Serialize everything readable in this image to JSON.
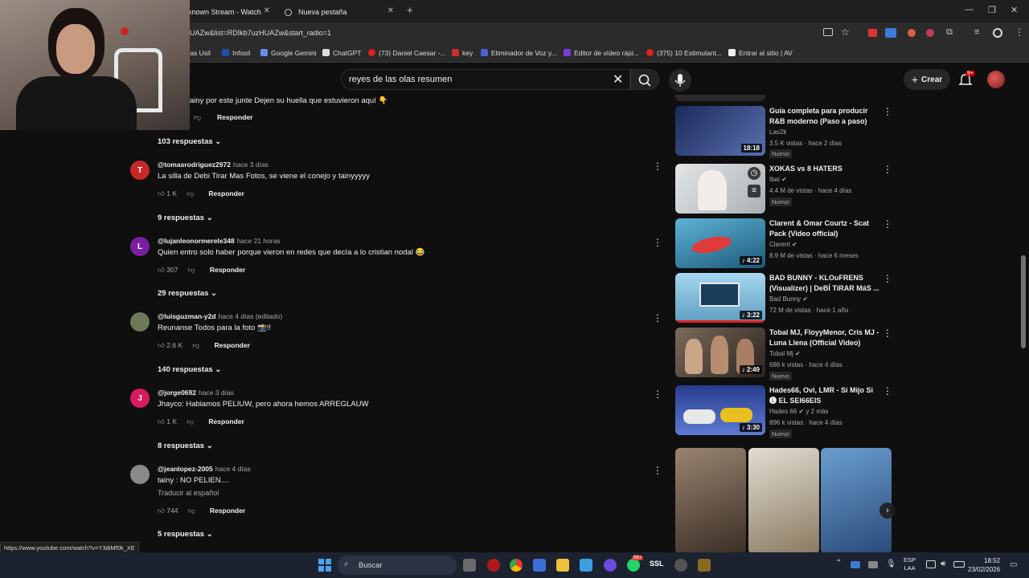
{
  "browser": {
    "tabs": [
      {
        "label": "known Stream - Watch"
      },
      {
        "label": "Nueva pestaña"
      }
    ],
    "url": "UAZw&list=RDIkb7uzHUAZw&start_radio=1",
    "bookmarks": [
      "vas Usil",
      "Infosil",
      "Google Gemini",
      "ChatGPT",
      "(73) Daniel Caesar -...",
      "key",
      "Eliminador de Voz y...",
      "Editor de vídeo rápi...",
      "(375) 10 Estimulant...",
      "Entrar al sitio | AV"
    ],
    "status_url": "https://www.youtube.com/watch?v=Y3diMf0k_XE"
  },
  "youtube": {
    "search_value": "reyes de las olas resumen",
    "create_label": "Crear",
    "notif_badge": "9+"
  },
  "comments": {
    "top_partial": {
      "text": "ainy por este junte Dejen su huella que estuvieron aquí 👇",
      "reply_label": "Responder"
    },
    "top_partial_replies": "103 respuestas",
    "items": [
      {
        "initial": "T",
        "color": "#c62828",
        "handle": "@tomasrodriguez2972",
        "time": "hace 3 días",
        "text": "La silla de Debi Tirar Mas Fotos, se viene el conejo y tainyyyyy",
        "likes": "1 K",
        "reply_label": "Responder",
        "replies": "9 respuestas"
      },
      {
        "initial": "L",
        "color": "#7b1fa2",
        "handle": "@lujanleonormerele348",
        "time": "hace 21 horas",
        "text": "Quien entro solo haber porque vieron en redes que decía a lo cristian nodal 😂",
        "likes": "307",
        "reply_label": "Responder",
        "replies": "29 respuestas"
      },
      {
        "initial": "",
        "color": "#6d7a5a",
        "handle": "@luisguzman-y2d",
        "time": "hace 4 días (editado)",
        "text": "Reunanse Todos para la foto 📸!!",
        "likes": "2.6 K",
        "reply_label": "Responder",
        "replies": "140 respuestas"
      },
      {
        "initial": "J",
        "color": "#d81b60",
        "handle": "@jorge0692",
        "time": "hace 3 días",
        "text": "Jhayco: Habiamos PELIUW, pero ahora hemos ARREGLAUW",
        "likes": "1 K",
        "reply_label": "Responder",
        "replies": "8 respuestas"
      },
      {
        "initial": "",
        "color": "#8a8a8a",
        "handle": "@jeanlopez-2005",
        "time": "hace 4 días",
        "text": "tainy : NO PELIEN....",
        "translate": "Traducir al español",
        "likes": "744",
        "reply_label": "Responder",
        "replies": "5 respuestas"
      }
    ]
  },
  "sidebar": {
    "videos": [
      {
        "title": "Guía completa para producir R&B moderno (Paso a paso)",
        "channel": "Las2k",
        "meta": "3.5 K vistas · hace 2 días",
        "badge": "Nuevo",
        "duration": "18:18",
        "thumb_color": "#1a2b5a"
      },
      {
        "title": "XOKAS vs 8 HATERS",
        "channel": "Ibai",
        "meta": "4.4 M de vistas · hace 4 días",
        "badge": "Nuevo",
        "duration": "",
        "thumb_color": "#cfd3d6"
      },
      {
        "title": "Clarent & Omar Courtz - Scat Pack (Video official)",
        "channel": "Clarent",
        "meta": "8.9 M de vistas · hace 6 meses",
        "badge": "",
        "duration": "4:22",
        "thumb_color": "#2c7fa3"
      },
      {
        "title": "BAD BUNNY - KLOuFRENS (Visualizer) | DeBÍ TiRAR MáS ...",
        "channel": "Bad Bunny",
        "meta": "72 M de vistas · hace 1 año",
        "badge": "",
        "duration": "3:22",
        "thumb_color": "#79b7d8"
      },
      {
        "title": "Tobal MJ, FloyyMenor, Cris MJ - Luna Llena (Official Video)",
        "channel": "Tobal Mj",
        "meta": "686 k vistas · hace 4 días",
        "badge": "Nuevo",
        "duration": "2:49",
        "thumb_color": "#5a4a3a"
      },
      {
        "title": "Hades66, Ovi, LMR - Si Mijo Si 🅔 EL SEI66EIS",
        "channel": "Hades 66",
        "channel_extra": "y 2 más",
        "meta": "896 k vistas · hace 4 días",
        "badge": "Nuevo",
        "duration": "3:30",
        "thumb_color": "#2a3d8f"
      }
    ],
    "shorts": [
      {
        "thumb_color": "#6b5a4c"
      },
      {
        "thumb_color": "#c8c3b8"
      },
      {
        "thumb_color": "#4a7fb8"
      }
    ]
  },
  "taskbar": {
    "search_placeholder": "Buscar",
    "lang_top": "ESP",
    "lang_bottom": "LAA",
    "time": "18:52",
    "date": "23/02/2026",
    "whatsapp_badge": "99+"
  }
}
